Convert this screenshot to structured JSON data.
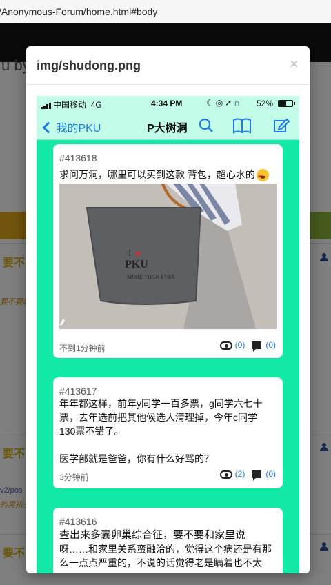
{
  "browser": {
    "url": "/Anonymous-Forum/home.html#body"
  },
  "background": {
    "heading_fragment": "u by",
    "rows": [
      {
        "title": "要不",
        "excerpt": "要不要转"
      },
      {
        "title": "要不",
        "link": "v2/pos",
        "excerpt": "的男孩子"
      },
      {
        "title": "要不"
      }
    ]
  },
  "modal": {
    "title": "img/shudong.png",
    "close_symbol": "×"
  },
  "phone": {
    "status": {
      "carrier": "中国移动",
      "network": "4G",
      "time": "4:34 PM",
      "battery": "52%"
    },
    "nav": {
      "back_label": "我的PKU",
      "title": "P大树洞"
    },
    "posts": [
      {
        "id": "#413618",
        "text": "求问万洞，哪里可以买到这款 背包，超心水的",
        "image_caption": "I ♥ PKU",
        "image_subtext": "MORE THAN EVER",
        "time": "不到1分钟前",
        "views": "(0)",
        "comments": "(0)"
      },
      {
        "id": "#413617",
        "text_lines": [
          "年年都这样，前年y同学一百多票，g同学六七十",
          "票，去年选前把其他候选人清理掉，今年c同学",
          "130票不错了。",
          "",
          "医学部就是爸爸，你有什么好骂的？"
        ],
        "time": "3分钟前",
        "views": "(2)",
        "comments": "(0)"
      },
      {
        "id": "#413616",
        "text_lines": [
          "查出来多囊卵巢综合征，要不要和家里说",
          "呀……和家里关系蛮融洽的，觉得这个病还是有那",
          "么一点点严重的，不说的话觉得老是瞒着也不太"
        ]
      }
    ]
  }
}
